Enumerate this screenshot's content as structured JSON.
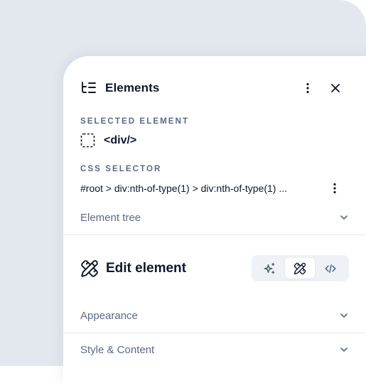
{
  "panel": {
    "title": "Elements",
    "title_icon": "tree-list-icon",
    "actions": {
      "more_icon": "more-vertical-icon",
      "close_icon": "close-icon"
    }
  },
  "selected_element": {
    "label": "SELECTED ELEMENT",
    "icon": "dashed-square-icon",
    "tag": "<div/>"
  },
  "css_selector": {
    "label": "CSS SELECTOR",
    "value": "#root > div:nth-of-type(1) > div:nth-of-type(1) ...",
    "more_icon": "more-vertical-icon"
  },
  "element_tree": {
    "label": "Element tree",
    "icon": "chevron-down-icon"
  },
  "edit_element": {
    "title": "Edit element",
    "icon": "pencil-ruler-icon",
    "modes": [
      {
        "name": "ai",
        "icon": "sparkles-icon",
        "active": false
      },
      {
        "name": "design",
        "icon": "pencil-ruler-icon",
        "active": true
      },
      {
        "name": "code",
        "icon": "code-icon",
        "active": false
      }
    ]
  },
  "sections": [
    {
      "label": "Appearance",
      "icon": "chevron-down-icon"
    },
    {
      "label": "Style & Content",
      "icon": "chevron-down-icon"
    }
  ],
  "colors": {
    "backdrop": "#e3e8ef",
    "panel": "#ffffff",
    "text_primary": "#0f172a",
    "text_muted": "#5b6b84",
    "divider": "#e2e8f0",
    "switch_bg": "#eef2f7"
  }
}
